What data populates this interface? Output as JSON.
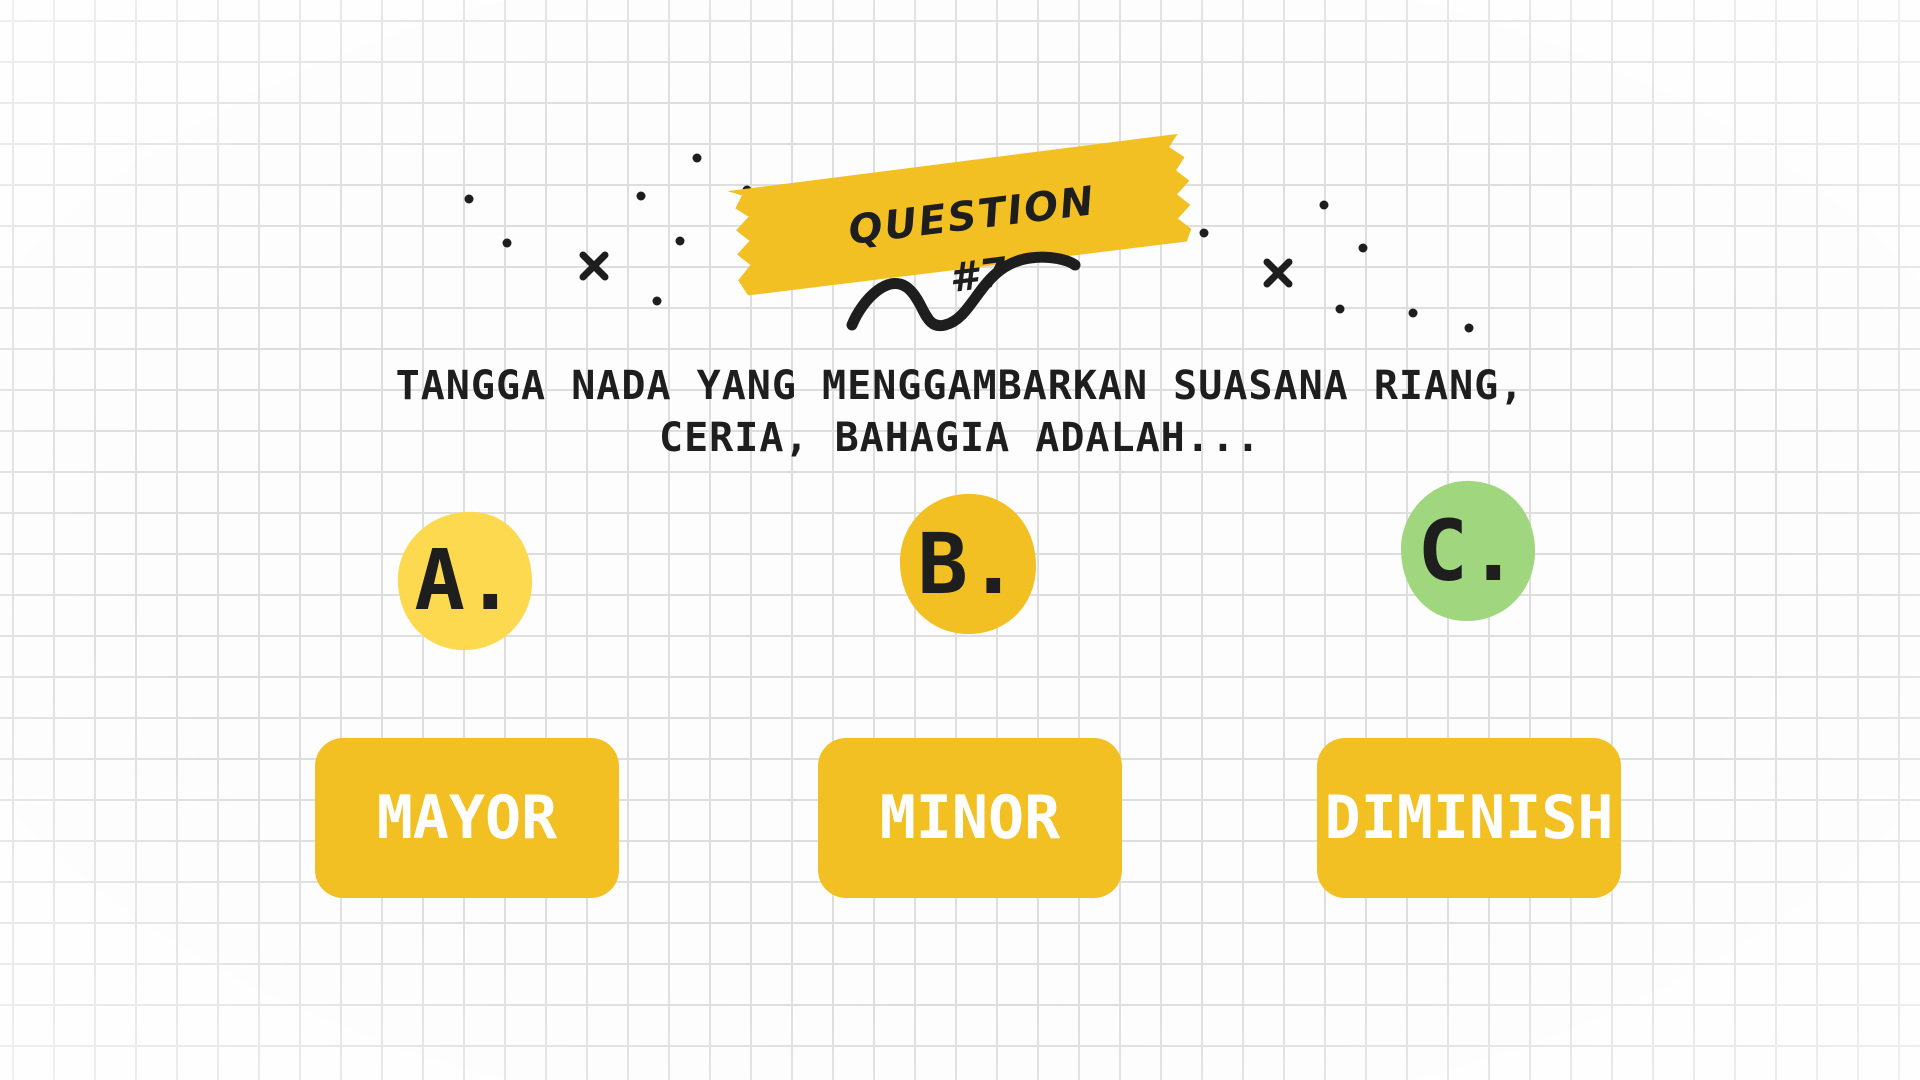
{
  "header": {
    "badge_label": "QUESTION #7"
  },
  "question": {
    "line1": "TANGGA NADA YANG MENGGAMBARKAN SUASANA RIANG,",
    "line2": "CERIA, BAHAGIA ADALAH..."
  },
  "options": [
    {
      "letter": "A.",
      "answer": "MAYOR",
      "blob_color": "#fdd94f"
    },
    {
      "letter": "B.",
      "answer": "MINOR",
      "blob_color": "#f2c022"
    },
    {
      "letter": "C.",
      "answer": "DIMINISH",
      "blob_color": "#9fd67e"
    }
  ],
  "colors": {
    "accent_yellow": "#f2c022",
    "light_yellow": "#fdd94f",
    "green": "#9fd67e",
    "ink": "#1e1e1e",
    "grid": "#d9d9d9"
  },
  "icons": [
    "cross-icon",
    "squiggle-icon",
    "dot-icon"
  ]
}
